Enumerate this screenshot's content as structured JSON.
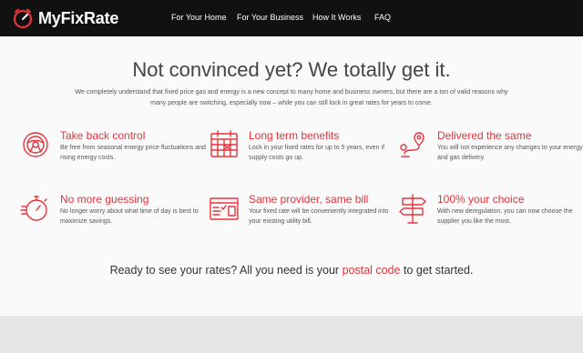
{
  "brand": {
    "name": "MyFixRate"
  },
  "nav": {
    "items": [
      "For Your Home",
      "For Your Business",
      "How It Works",
      "FAQ"
    ]
  },
  "headline": "Not convinced yet? We totally get it.",
  "intro": "We completely understand that fixed price gas and energy is a new concept to many home and business owners, but there are a ton of valid reasons why many people are switching, especially now – while you can still lock in great rates for years to come.",
  "features": [
    {
      "title": "Take back control",
      "desc": "Be free from seasonal energy price fluctuations and rising energy costs.",
      "icon": "steering-wheel-icon"
    },
    {
      "title": "Long term benefits",
      "desc": "Lock in your fixed rates for up to 5 years, even if supply costs go up.",
      "icon": "calendar-icon"
    },
    {
      "title": "Delivered the same",
      "desc": "You will not experience any changes to your energy and gas delivery.",
      "icon": "route-pin-icon"
    },
    {
      "title": "No more guessing",
      "desc": "No longer worry about what time of day is best to maximize savings.",
      "icon": "stopwatch-icon"
    },
    {
      "title": "Same provider, same bill",
      "desc": "Your fixed rate will be conveniently integrated into your existing utility bill.",
      "icon": "bill-icon"
    },
    {
      "title": "100% your choice",
      "desc": "With new deregulation, you can now choose the supplier you like the most.",
      "icon": "signpost-icon"
    }
  ],
  "cta": {
    "before": "Ready to see your rates? All you need is your ",
    "highlight": "postal code",
    "after": " to get started."
  },
  "colors": {
    "accent": "#e8323c",
    "nav_bg": "#111111",
    "band": "#e6e6e6"
  }
}
